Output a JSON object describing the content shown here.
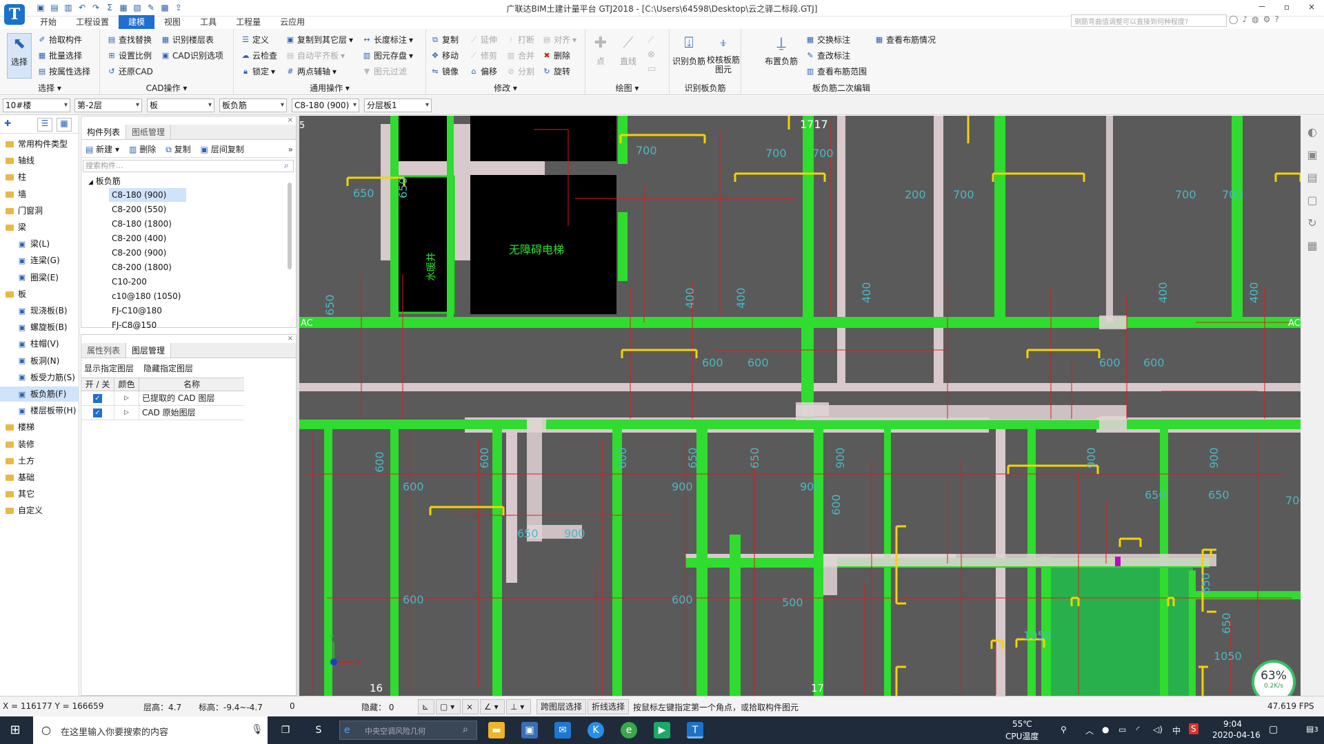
{
  "app": {
    "title": "广联达BIM土建计量平台 GTJ2018 - [C:\\Users\\64598\\Desktop\\云之驿二标段.GTJ]",
    "search_placeholder": "钢筋弯曲值调整可以直接到何种程度?",
    "logo": "T",
    "window_controls": [
      "－",
      "▫",
      "×"
    ]
  },
  "menu": [
    "开始",
    "工程设置",
    "建模",
    "视图",
    "工具",
    "工程量",
    "云应用"
  ],
  "menu_active": "建模",
  "ribbon": {
    "select_group": {
      "label": "选择",
      "big": "选择",
      "items": [
        "拾取构件",
        "批量选择",
        "按属性选择"
      ]
    },
    "cad_group": {
      "label": "CAD操作",
      "items": [
        "查找替换",
        "识别楼层表",
        "设置比例",
        "CAD识别选项",
        "还原CAD"
      ]
    },
    "common_group": {
      "label": "通用操作",
      "items": [
        "定义",
        "复制到其它层",
        "长度标注",
        "云检查",
        "自动平齐板",
        "图元存盘",
        "锁定",
        "两点辅轴",
        "图元过滤"
      ]
    },
    "modify_group": {
      "label": "修改",
      "items": [
        "复制",
        "延伸",
        "打断",
        "对齐",
        "移动",
        "修剪",
        "合并",
        "删除",
        "镜像",
        "偏移",
        "分割",
        "旋转"
      ]
    },
    "draw_group": {
      "label": "绘图",
      "items": [
        "点",
        "直线"
      ]
    },
    "recog_group": {
      "label": "识别板负筋",
      "items": [
        "识别负筋",
        "校核板筋图元"
      ]
    },
    "edit_group": {
      "label": "板负筋二次编辑",
      "items": [
        "布置负筋",
        "交换标注",
        "查看布筋情况",
        "查改标注",
        "查看布筋范围"
      ]
    }
  },
  "filters": [
    "10#楼",
    "第-2层",
    "板",
    "板负筋",
    "C8-180 (900)",
    "分层板1"
  ],
  "leftnav": [
    {
      "label": "常用构件类型",
      "level": 0
    },
    {
      "label": "轴线",
      "level": 0
    },
    {
      "label": "柱",
      "level": 0
    },
    {
      "label": "墙",
      "level": 0
    },
    {
      "label": "门窗洞",
      "level": 0
    },
    {
      "label": "梁",
      "level": 0
    },
    {
      "label": "梁(L)",
      "level": 1
    },
    {
      "label": "连梁(G)",
      "level": 1
    },
    {
      "label": "圈梁(E)",
      "level": 1
    },
    {
      "label": "板",
      "level": 0
    },
    {
      "label": "现浇板(B)",
      "level": 1
    },
    {
      "label": "螺旋板(B)",
      "level": 1
    },
    {
      "label": "柱帽(V)",
      "level": 1
    },
    {
      "label": "板洞(N)",
      "level": 1
    },
    {
      "label": "板受力筋(S)",
      "level": 1
    },
    {
      "label": "板负筋(F)",
      "level": 1,
      "selected": true
    },
    {
      "label": "楼层板带(H)",
      "level": 1
    },
    {
      "label": "楼梯",
      "level": 0
    },
    {
      "label": "装修",
      "level": 0
    },
    {
      "label": "土方",
      "level": 0
    },
    {
      "label": "基础",
      "level": 0
    },
    {
      "label": "其它",
      "level": 0
    },
    {
      "label": "自定义",
      "level": 0
    }
  ],
  "complist": {
    "tabs": [
      "构件列表",
      "图纸管理"
    ],
    "toolbar": [
      "新建",
      "删除",
      "复制",
      "层间复制"
    ],
    "search_placeholder": "搜索构件...",
    "root": "板负筋",
    "items": [
      "C8-180 (900)",
      "C8-200 (550)",
      "C8-180 (1800)",
      "C8-200 (400)",
      "C8-200 (900)",
      "C8-200 (1800)",
      "C10-200",
      "c10@180 (1050)",
      "FJ-C10@180",
      "FJ-C8@150"
    ]
  },
  "layers": {
    "tabs": [
      "属性列表",
      "图层管理"
    ],
    "actions": [
      "显示指定图层",
      "隐藏指定图层"
    ],
    "headers": [
      "开 / 关",
      "颜色",
      "名称"
    ],
    "rows": [
      "已提取的 CAD 图层",
      "CAD 原始图层"
    ]
  },
  "canvas": {
    "axis_labels": [
      "1717",
      "AC",
      "AC",
      "16",
      "17",
      "5"
    ],
    "room_labels": [
      "无障碍电梯",
      "水暖井"
    ],
    "dims": [
      "700",
      "650",
      "650",
      "700",
      "700",
      "200",
      "700",
      "700",
      "700",
      "650",
      "400",
      "400",
      "400",
      "400",
      "400",
      "600",
      "600",
      "600",
      "600",
      "600",
      "600",
      "600",
      "600",
      "650",
      "650",
      "650",
      "900",
      "900",
      "900",
      "900",
      "900",
      "900",
      "600",
      "600",
      "600",
      "650",
      "650",
      "500",
      "700",
      "650",
      "650",
      "1050",
      "1050"
    ],
    "axis_y": "Y",
    "axis_x": "X"
  },
  "status": {
    "coords": "X = 116177 Y = 166659",
    "floor_height": "层高：4.7",
    "elevation": "标高：-9.4~-4.7",
    "zero": "0",
    "hidden": "隐藏：  0",
    "btns": [
      "跨图层选择",
      "折线选择"
    ],
    "hint": "按鼠标左键指定第一个角点，或拾取构件图元",
    "fps": "47.619 FPS"
  },
  "gauge": {
    "percent": "63%",
    "speed": "0.2K/s"
  },
  "taskbar": {
    "search": "在这里输入你要搜索的内容",
    "browser_text": "中央空调风险几何",
    "temp": "55℃",
    "temp_label": "CPU温度",
    "time": "9:04",
    "date": "2020-04-16",
    "ime": "中",
    "notif": "3"
  }
}
